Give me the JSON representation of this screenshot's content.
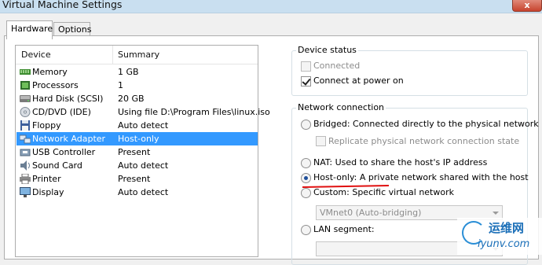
{
  "window": {
    "title": "Virtual Machine Settings",
    "close_glyph": "x"
  },
  "tabs": [
    {
      "label": "Hardware",
      "active": true
    },
    {
      "label": "Options",
      "active": false
    }
  ],
  "device_list": {
    "columns": [
      "Device",
      "Summary"
    ],
    "rows": [
      {
        "icon": "memory-icon",
        "device": "Memory",
        "summary": "1 GB"
      },
      {
        "icon": "processor-icon",
        "device": "Processors",
        "summary": "1"
      },
      {
        "icon": "hard-disk-icon",
        "device": "Hard Disk (SCSI)",
        "summary": "20 GB"
      },
      {
        "icon": "cd-dvd-icon",
        "device": "CD/DVD (IDE)",
        "summary": "Using file D:\\Program Files\\linux.iso"
      },
      {
        "icon": "floppy-icon",
        "device": "Floppy",
        "summary": "Auto detect"
      },
      {
        "icon": "network-adapter-icon",
        "device": "Network Adapter",
        "summary": "Host-only",
        "selected": true
      },
      {
        "icon": "usb-icon",
        "device": "USB Controller",
        "summary": "Present"
      },
      {
        "icon": "sound-card-icon",
        "device": "Sound Card",
        "summary": "Auto detect"
      },
      {
        "icon": "printer-icon",
        "device": "Printer",
        "summary": "Present"
      },
      {
        "icon": "display-icon",
        "device": "Display",
        "summary": "Auto detect"
      }
    ]
  },
  "device_status": {
    "label": "Device status",
    "connected": {
      "label": "Connected",
      "checked": false,
      "enabled": false
    },
    "connect_at_power_on": {
      "label": "Connect at power on",
      "checked": true,
      "enabled": true
    }
  },
  "network_connection": {
    "label": "Network connection",
    "bridged": {
      "label": "Bridged: Connected directly to the physical network",
      "selected": false
    },
    "replicate": {
      "label": "Replicate physical network connection state",
      "checked": false,
      "enabled": false
    },
    "nat": {
      "label": "NAT: Used to share the host's IP address",
      "selected": false
    },
    "host_only": {
      "label": "Host-only: A private network shared with the host",
      "selected": true
    },
    "custom": {
      "label": "Custom: Specific virtual network",
      "selected": false
    },
    "vmnet_value": "VMnet0 (Auto-bridging)",
    "lan_segment": {
      "label": "LAN segment:",
      "selected": false
    }
  },
  "watermark": {
    "cn": "运维网",
    "en": "iyunv.com"
  },
  "colors": {
    "selection": "#3399ff",
    "annotation": "#e01010",
    "titlebar": "#c9dff0"
  }
}
